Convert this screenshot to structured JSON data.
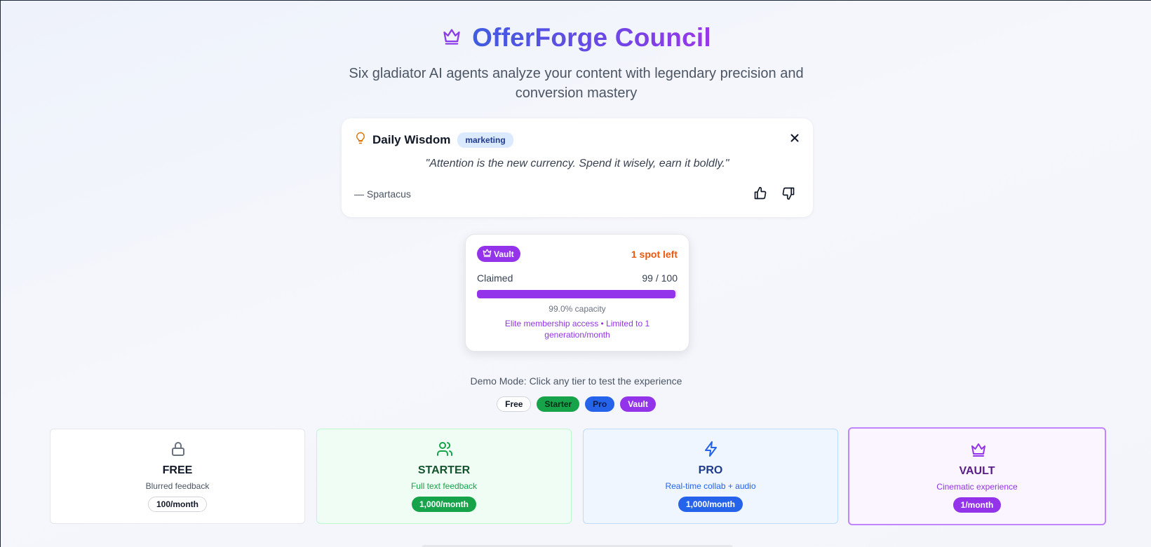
{
  "header": {
    "title": "OfferForge Council",
    "title_icon": "crown-icon",
    "subtitle": "Six gladiator AI agents analyze your content with legendary precision and conversion mastery"
  },
  "wisdom": {
    "icon": "lightbulb-icon",
    "title": "Daily Wisdom",
    "tag": "marketing",
    "quote": "\"Attention is the new currency. Spend it wisely, earn it boldly.\"",
    "author": "— Spartacus"
  },
  "vault_status": {
    "badge": "Vault",
    "spots_left": "1 spot left",
    "claimed_label": "Claimed",
    "claimed_count": "99 / 100",
    "claimed_fraction": 0.99,
    "capacity": "99.0% capacity",
    "description": "Elite membership access • Limited to 1 generation/month"
  },
  "demo": {
    "text": "Demo Mode: Click any tier to test the experience",
    "pills": [
      "Free",
      "Starter",
      "Pro",
      "Vault"
    ]
  },
  "tiers": [
    {
      "name": "FREE",
      "description": "Blurred feedback",
      "limit": "100/month",
      "icon": "lock-icon"
    },
    {
      "name": "STARTER",
      "description": "Full text feedback",
      "limit": "1,000/month",
      "icon": "users-icon"
    },
    {
      "name": "PRO",
      "description": "Real-time collab + audio",
      "limit": "1,000/month",
      "icon": "lightning-icon"
    },
    {
      "name": "VAULT",
      "description": "Cinematic experience",
      "limit": "1/month",
      "icon": "crown-icon"
    }
  ],
  "colors": {
    "title_gradient_start": "#3f5ce0",
    "title_gradient_end": "#9a37e8",
    "vault_purple": "#9333ea",
    "starter_green": "#16a34a",
    "pro_blue": "#2563eb",
    "warning_orange": "#ea580c",
    "wisdom_bulb": "#d97706"
  }
}
